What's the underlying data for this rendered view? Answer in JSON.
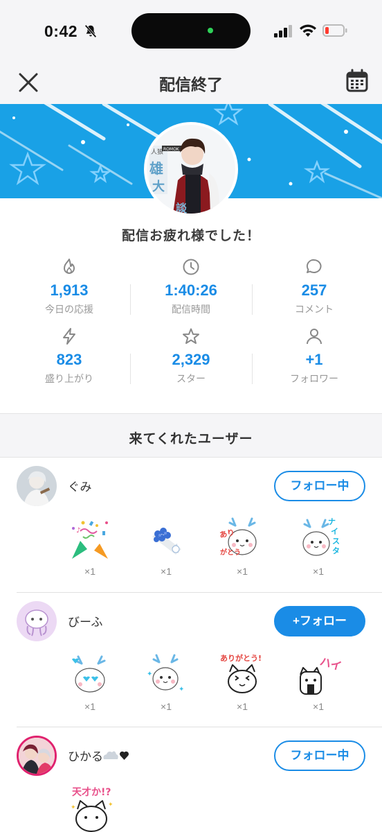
{
  "status_bar": {
    "time": "0:42"
  },
  "header": {
    "title": "配信終了"
  },
  "banner": {
    "avatar_name": "hero-avatar"
  },
  "done_message": "配信お疲れ様でした！",
  "stats": [
    {
      "icon": "flame-icon",
      "value": "1,913",
      "label": "今日の応援"
    },
    {
      "icon": "clock-icon",
      "value": "1:40:26",
      "label": "配信時間"
    },
    {
      "icon": "comment-icon",
      "value": "257",
      "label": "コメント"
    },
    {
      "icon": "lightning-icon",
      "value": "823",
      "label": "盛り上がり"
    },
    {
      "icon": "star-icon",
      "value": "2,329",
      "label": "スター"
    },
    {
      "icon": "person-icon",
      "value": "+1",
      "label": "フォロワー"
    }
  ],
  "section_title": "来てくれたユーザー",
  "users": [
    {
      "name": "ぐみ",
      "follow_label": "フォロー中",
      "following": true,
      "gifts": [
        {
          "type": "party",
          "count": "×1"
        },
        {
          "type": "bouquet",
          "count": "×1"
        },
        {
          "type": "deer-thanks",
          "count": "×1"
        },
        {
          "type": "deer-nice",
          "count": "×1"
        }
      ]
    },
    {
      "name": "びーふ",
      "follow_label": "+フォロー",
      "following": false,
      "gifts": [
        {
          "type": "deer-heart",
          "count": "×1"
        },
        {
          "type": "deer-sparkle",
          "count": "×1"
        },
        {
          "type": "cat-thanks",
          "count": "×1"
        },
        {
          "type": "cat-hai",
          "count": "×1"
        }
      ]
    },
    {
      "name": "ひかる",
      "follow_label": "フォロー中",
      "following": true,
      "gifts": [
        {
          "type": "cat-genius",
          "count": ""
        }
      ]
    }
  ],
  "colors": {
    "accent": "#1a8ce6",
    "banner": "#19a1e6"
  }
}
